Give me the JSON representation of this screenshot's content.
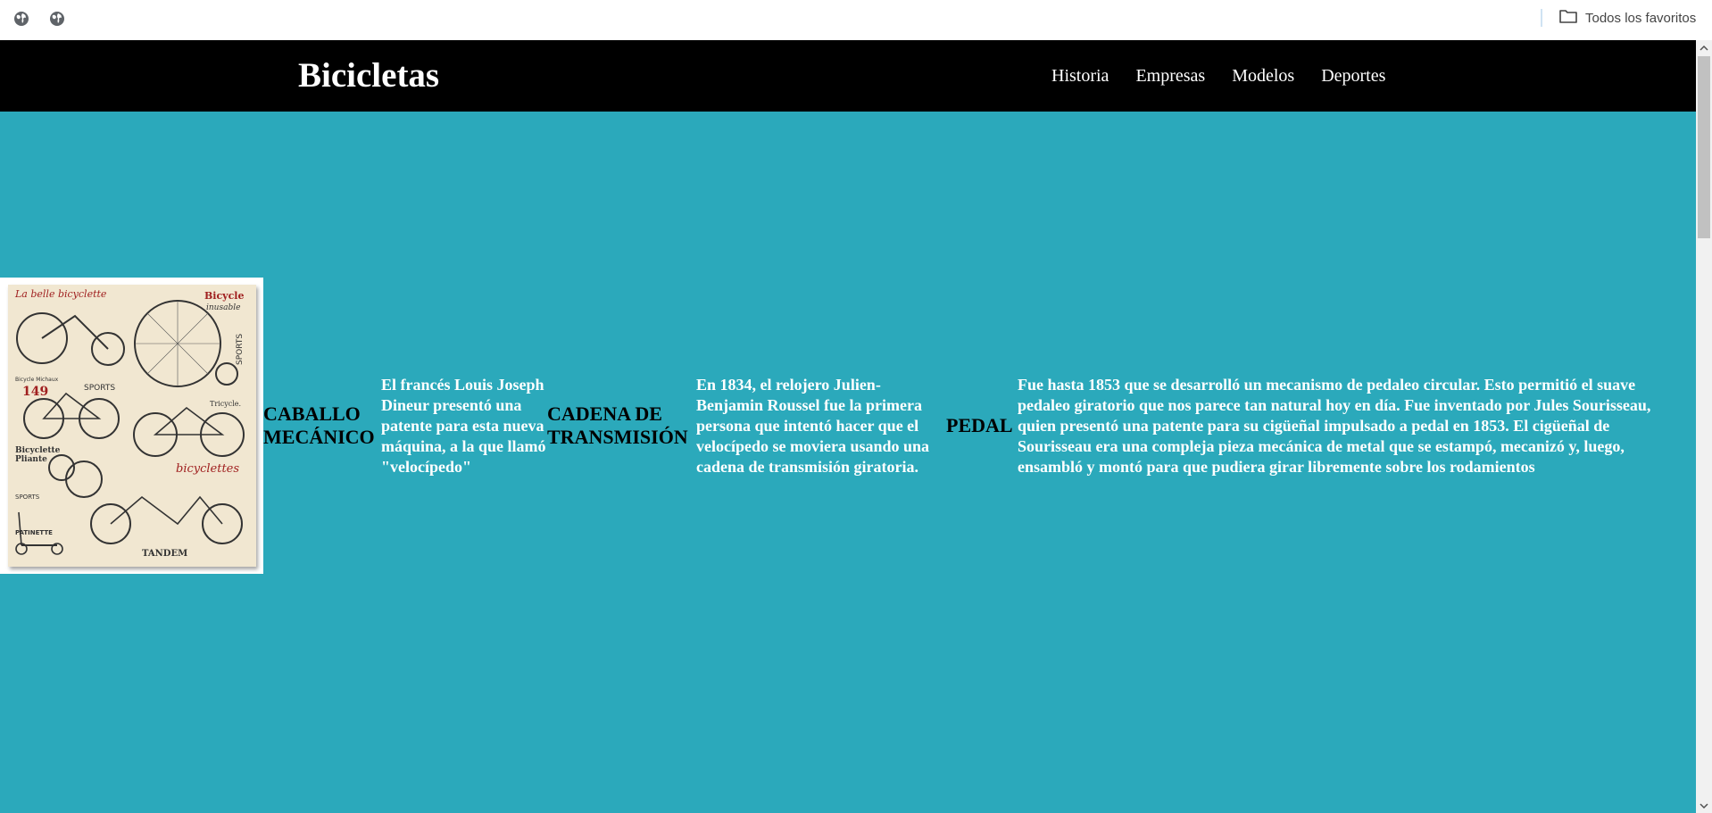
{
  "browser": {
    "bookmarks": [
      {
        "icon": "globe-icon"
      },
      {
        "icon": "globe-icon"
      }
    ],
    "all_favorites_label": "Todos los favoritos"
  },
  "site": {
    "title": "Bicicletas",
    "nav": [
      "Historia",
      "Empresas",
      "Modelos",
      "Deportes"
    ],
    "background_color": "#2ba9bb",
    "header_color": "#000000"
  },
  "content": {
    "sections": [
      {
        "heading": "CABALLO MECÁNICO",
        "text": "El francés Louis Joseph Dineur presentó una patente para esta nueva máquina, a la que llamó \"velocípedo\""
      },
      {
        "heading": "CADENA DE TRANSMISIÓN",
        "text": "En 1834, el relojero Julien-Benjamin Roussel fue la primera persona que intentó hacer que el velocípedo se moviera usando una cadena de transmisión giratoria."
      },
      {
        "heading": "PEDAL",
        "text": "Fue hasta 1853 que se desarrolló un mecanismo de pedaleo circular. Esto permitió el suave pedaleo giratorio que nos parece tan natural hoy en día. Fue inventado por Jules Sourisseau, quien presentó una patente para su cigüeñal impulsado a pedal en 1853. El cigüeñal de Sourisseau era una compleja pieza mecánica de metal que se estampó, mecanizó y, luego, ensambló y montó para que pudiera girar libremente sobre los rodamientos"
      }
    ],
    "poster": {
      "labels": [
        "La belle bicyclette",
        "Bicycle",
        "inusable",
        "SPORTS",
        "Bicycle Michaux",
        "149",
        "SPORTS",
        "Tricycle.",
        "Bicyclette",
        "Pliante",
        "bicyclettes",
        "SPORTS",
        "PATINETTE",
        "TANDEM"
      ]
    }
  }
}
